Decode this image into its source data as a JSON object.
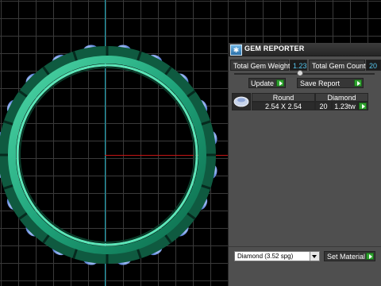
{
  "panel": {
    "title": "GEM REPORTER",
    "icon": "gem-reporter-icon",
    "total_weight_label": "Total Gem Weight",
    "total_weight_value": "1.23",
    "total_count_label": "Total Gem Count",
    "total_count_value": "20",
    "slider_position": 0.47,
    "update_label": "Update",
    "save_report_label": "Save Report",
    "table": {
      "header_shape": "Round",
      "header_material": "Diamond",
      "size": "2.54 X 2.54",
      "count": "20",
      "weight": "1.23tw"
    },
    "material_select_value": "Diamond     (3.52 spg)",
    "set_material_label": "Set Material"
  },
  "colors": {
    "ring_green": "#1fa37a",
    "gem_blue": "#6a8fe0",
    "accent_cyan": "#56c8f0",
    "axis_red": "#c41414",
    "axis_cyan": "#18a6b8",
    "action_green": "#2fa32f"
  }
}
